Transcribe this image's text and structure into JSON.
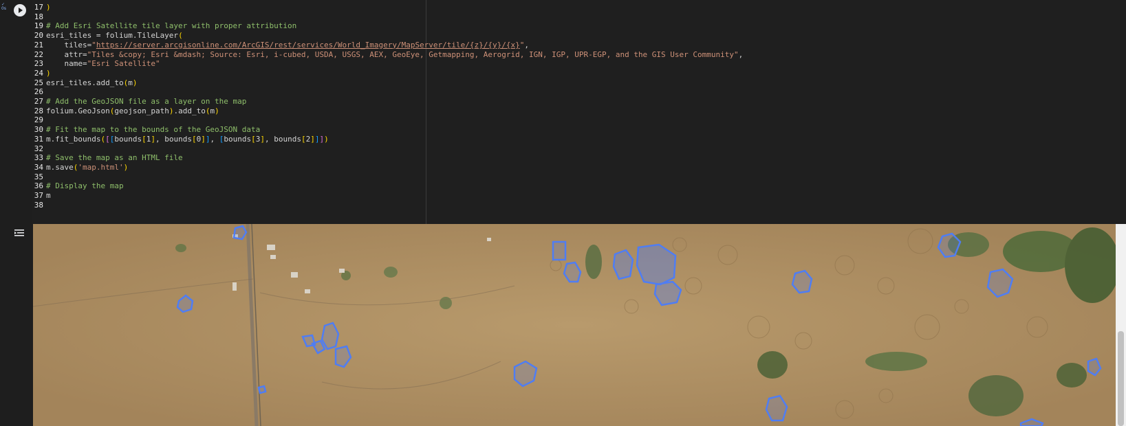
{
  "cell": {
    "status": "0s",
    "code_lines": [
      {
        "n": "17",
        "text": ")"
      },
      {
        "n": "18",
        "text": ""
      },
      {
        "n": "19",
        "text": "# Add Esri Satellite tile layer with proper attribution"
      },
      {
        "n": "20",
        "text": "esri_tiles = folium.TileLayer("
      },
      {
        "n": "21",
        "text": "    tiles=\"https://server.arcgisonline.com/ArcGIS/rest/services/World_Imagery/MapServer/tile/{z}/{y}/{x}\","
      },
      {
        "n": "22",
        "text": "    attr=\"Tiles &copy; Esri &mdash; Source: Esri, i-cubed, USDA, USGS, AEX, GeoEye, Getmapping, Aerogrid, IGN, IGP, UPR-EGP, and the GIS User Community\","
      },
      {
        "n": "23",
        "text": "    name=\"Esri Satellite\""
      },
      {
        "n": "24",
        "text": ")"
      },
      {
        "n": "25",
        "text": "esri_tiles.add_to(m)"
      },
      {
        "n": "26",
        "text": ""
      },
      {
        "n": "27",
        "text": "# Add the GeoJSON file as a layer on the map"
      },
      {
        "n": "28",
        "text": "folium.GeoJson(geojson_path).add_to(m)"
      },
      {
        "n": "29",
        "text": ""
      },
      {
        "n": "30",
        "text": "# Fit the map to the bounds of the GeoJSON data"
      },
      {
        "n": "31",
        "text": "m.fit_bounds([[bounds[1], bounds[0]], [bounds[3], bounds[2]]])"
      },
      {
        "n": "32",
        "text": ""
      },
      {
        "n": "33",
        "text": "# Save the map as an HTML file"
      },
      {
        "n": "34",
        "text": "m.save('map.html')"
      },
      {
        "n": "35",
        "text": ""
      },
      {
        "n": "36",
        "text": "# Display the map"
      },
      {
        "n": "37",
        "text": "m"
      },
      {
        "n": "38",
        "text": ""
      }
    ]
  },
  "map": {
    "layer": "satellite-imagery",
    "polygon_color": "#4f7df3",
    "ground_color": "#b08f62"
  },
  "colors": {
    "editor_bg": "#1f1f1f",
    "comment": "#8fbf6b",
    "string": "#ce9178",
    "bracket_1": "#ffd700",
    "bracket_2": "#da70d6",
    "bracket_3": "#179fff"
  }
}
